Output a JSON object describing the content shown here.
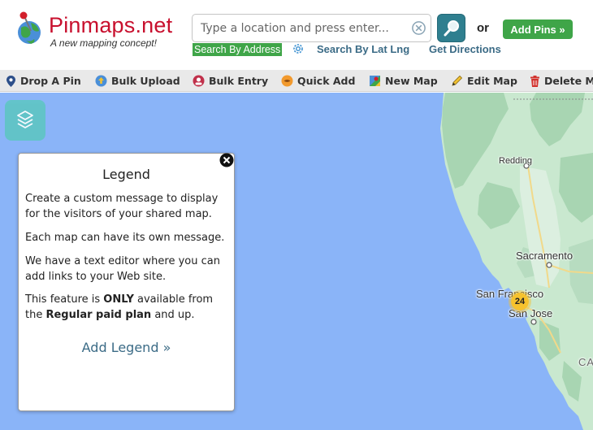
{
  "header": {
    "brand": "Pinmaps.net",
    "tagline": "A new mapping concept!",
    "search_placeholder": "Type a location and press enter...",
    "or_label": "or",
    "add_pins_label": "Add Pins »",
    "search_by_address_label": "Search By Address",
    "search_by_latlng_label": "Search By Lat Lng",
    "get_directions_label": "Get Directions"
  },
  "toolbar": {
    "items": [
      {
        "label": "Drop A Pin",
        "icon": "pin-icon"
      },
      {
        "label": "Bulk Upload",
        "icon": "upload-icon"
      },
      {
        "label": "Bulk Entry",
        "icon": "bulk-entry-icon"
      },
      {
        "label": "Quick Add",
        "icon": "quick-add-icon"
      },
      {
        "label": "New Map",
        "icon": "new-map-icon"
      },
      {
        "label": "Edit Map",
        "icon": "pencil-icon"
      },
      {
        "label": "Delete Ma",
        "icon": "trash-icon"
      }
    ]
  },
  "legend": {
    "title": "Legend",
    "p1": "Create a custom message to display for the visitors of your shared map.",
    "p2": "Each map can have its own message.",
    "p3": "We have a text editor where you can add links to your Web site.",
    "p4_pre": "This feature is ",
    "p4_bold1": "ONLY",
    "p4_mid": " available from the ",
    "p4_bold2": "Regular paid plan",
    "p4_post": " and up.",
    "add_label": "Add Legend »"
  },
  "map": {
    "cities": {
      "redding": "Redding",
      "sacramento": "Sacramento",
      "san_francisco": "San Francisco",
      "san_jose": "San Jose",
      "ca": "CA"
    },
    "cluster_count": "24",
    "colors": {
      "ocean": "#8ab4f8",
      "land": "#c9e8cf",
      "forest": "#a8d5b2",
      "accent_green": "#3fa548",
      "link_blue": "#3b6b86",
      "brand_red": "#c8102e"
    }
  }
}
